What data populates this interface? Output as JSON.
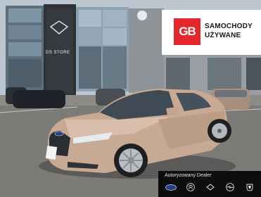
{
  "badge": {
    "logo_text": "GB",
    "line1": "SAMOCHODY",
    "line2": "UŻYWANE"
  },
  "store_sign": "DS STORE",
  "dealer_bar": {
    "title": "Autoryzowany Dealer",
    "brands": [
      "ford-logo-icon",
      "citroen-logo-icon",
      "ds-logo-icon",
      "opel-logo-icon",
      "peugeot-logo-icon"
    ]
  },
  "colors": {
    "brand_red": "#e4262d",
    "car_paint": "#c8a993",
    "bar_bg": "#0d0d0f"
  }
}
